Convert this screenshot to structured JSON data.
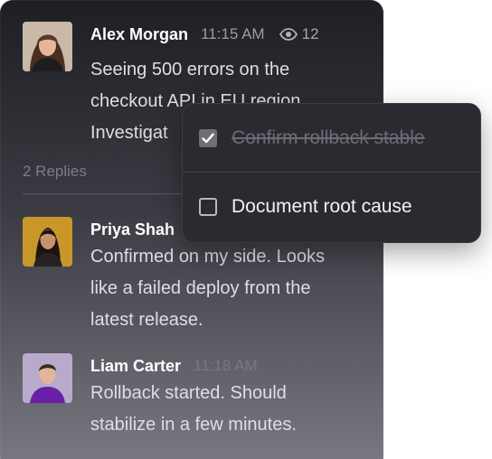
{
  "thread": {
    "root": {
      "author": "Alex Morgan",
      "time": "11:15 AM",
      "views": "12",
      "lines": [
        "Seeing 500 errors on the",
        "checkout API in EU region.",
        "Investigat"
      ]
    },
    "replies_label": "2 Replies",
    "replies": [
      {
        "author": "Priya Shah",
        "time": "",
        "lines": [
          "Confirmed on my side. Looks",
          "like a failed deploy from the",
          "latest release."
        ]
      },
      {
        "author": "Liam Carter",
        "time": "11:18 AM",
        "lines": [
          "Rollback started. Should",
          "stabilize in a few minutes."
        ]
      }
    ]
  },
  "checklist": {
    "items": [
      {
        "label": "Confirm rollback stable",
        "checked": true
      },
      {
        "label": "Document root cause",
        "checked": false
      }
    ]
  },
  "icons": {
    "views": "eye-icon",
    "check": "checkmark-icon"
  },
  "colors": {
    "panel_top": "#1e1e24",
    "panel_bottom": "#7a7a82",
    "popover_bg": "#2a2a31"
  }
}
